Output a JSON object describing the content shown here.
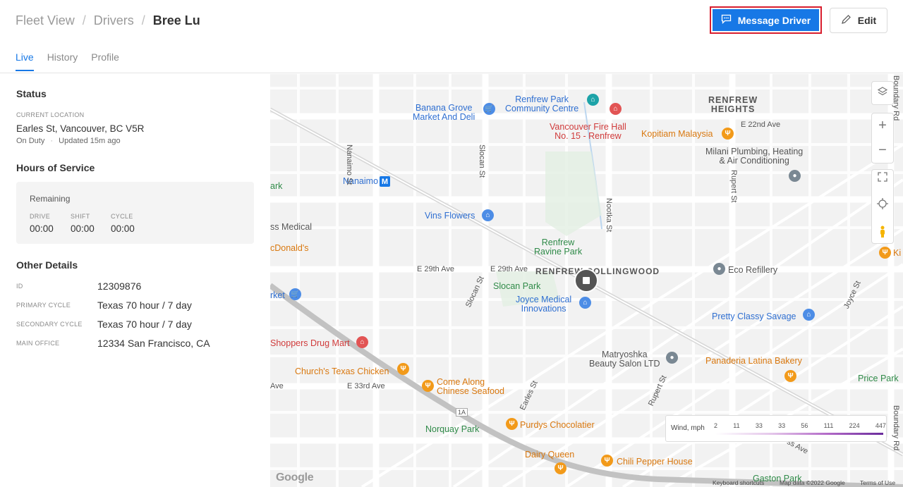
{
  "breadcrumb": {
    "items": [
      "Fleet View",
      "Drivers",
      "Bree Lu"
    ],
    "separator": "/"
  },
  "actions": {
    "message_label": "Message Driver",
    "edit_label": "Edit"
  },
  "tabs": [
    "Live",
    "History",
    "Profile"
  ],
  "status": {
    "title": "Status",
    "location_label": "CURRENT LOCATION",
    "location": "Earles St, Vancouver, BC V5R",
    "duty": "On Duty",
    "updated": "Updated 15m ago"
  },
  "hos": {
    "title": "Hours of Service",
    "remaining_label": "Remaining",
    "drive_label": "DRIVE",
    "drive": "00:00",
    "shift_label": "SHIFT",
    "shift": "00:00",
    "cycle_label": "CYCLE",
    "cycle": "00:00"
  },
  "details": {
    "title": "Other Details",
    "rows": [
      {
        "label": "ID",
        "value": "12309876"
      },
      {
        "label": "PRIMARY CYCLE",
        "value": "Texas 70 hour / 7 day"
      },
      {
        "label": "SECONDARY CYCLE",
        "value": "Texas 70 hour / 7 day"
      },
      {
        "label": "MAIN OFFICE",
        "value": "12334 San Francisco, CA"
      }
    ]
  },
  "map": {
    "pois": {
      "banana_grove": "Banana Grove\nMarket And Deli",
      "renfrew_cc": "Renfrew Park\nCommunity Centre",
      "fire_hall": "Vancouver Fire Hall\nNo. 15 - Renfrew",
      "kopitiam": "Kopitiam Malaysia",
      "milani": "Milani Plumbing, Heating\n& Air Conditioning",
      "renfrew_heights": "RENFREW\nHEIGHTS",
      "nanaimo": "Nanaimo",
      "vins": "Vins Flowers",
      "renfrew_ravine": "Renfrew\nRavine Park",
      "renfrew_collingwood": "RENFREW-COLLINGWOOD",
      "eco_refillery": "Eco Refillery",
      "slocan_park": "Slocan Park",
      "joyce_medical": "Joyce Medical\nInnovations",
      "pretty_classy": "Pretty Classy Savage",
      "shoppers": "Shoppers Drug Mart",
      "churchs": "Church's Texas Chicken",
      "come_along": "Come Along\nChinese Seafood",
      "matryoshka": "Matryoshka\nBeauty Salon LTD",
      "panaderia": "Panaderia Latina Bakery",
      "price_park": "Price Park",
      "norquay": "Norquay Park",
      "purdys": "Purdys Chocolatier",
      "dairy_queen": "Dairy Queen",
      "chili_pepper": "Chili Pepper House",
      "ark": "ark",
      "ss_medical": "ss Medical",
      "mcdonalds": "cDonald's",
      "market": "rket",
      "ki": "Ki",
      "gaston": "Gaston Park"
    },
    "streets": {
      "e22": "E 22nd Ave",
      "e29a": "E 29th Ave",
      "e29b": "E 29th Ave",
      "e33": "E 33rd Ave",
      "ave": "Ave",
      "nanaimo_st": "Nanaimo St",
      "slocan_st": "Slocan St",
      "slocan_st2": "Slocan St",
      "nootka": "Nootka St",
      "rupert": "Rupert St",
      "rupert2": "Rupert St",
      "earles": "Earles St",
      "joyce": "Joyce St",
      "boundary": "Boundary Rd",
      "boundary2": "Boundary Rd",
      "hwy": "1A",
      "ss_ave": "ss Ave"
    },
    "legend": {
      "title": "Wind, mph",
      "values": [
        "2",
        "11",
        "33",
        "33",
        "56",
        "111",
        "224",
        "447"
      ]
    },
    "footer": {
      "shortcuts": "Keyboard shortcuts",
      "mapdata": "Map data ©2022 Google",
      "terms": "Terms of Use",
      "logo": "Google"
    }
  }
}
